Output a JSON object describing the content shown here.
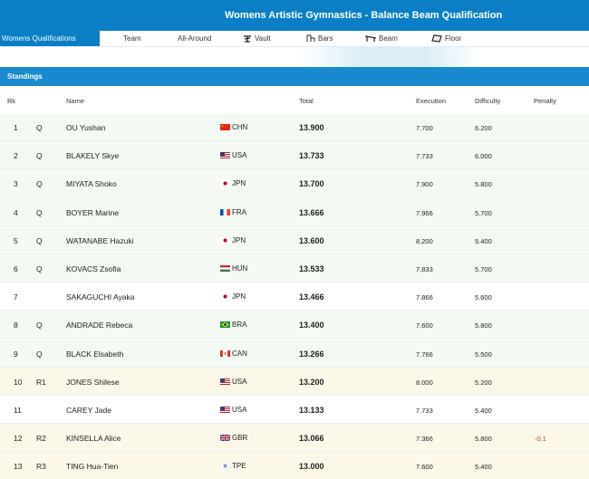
{
  "header": {
    "title": "Womens Artistic Gymnastics - Balance Beam Qualification"
  },
  "tabs": [
    {
      "label": "Womens Qualifications",
      "icon": "",
      "active": true
    },
    {
      "label": "Team",
      "icon": ""
    },
    {
      "label": "All-Around",
      "icon": ""
    },
    {
      "label": "Vault",
      "icon": "vault-icon"
    },
    {
      "label": "Bars",
      "icon": "bars-icon"
    },
    {
      "label": "Beam",
      "icon": "beam-icon"
    },
    {
      "label": "Floor",
      "icon": "floor-icon"
    }
  ],
  "standings": {
    "label": "Standings"
  },
  "columns": {
    "rk": "Rk",
    "name": "Name",
    "total": "Total",
    "execution": "Execution",
    "difficulty": "Difficulty",
    "penalty": "Penalty"
  },
  "colors": {
    "accent": "#0a7fc6",
    "qualified_bg": "#f4faf3",
    "reserve_bg": "#fbf8e8"
  },
  "rows": [
    {
      "rk": "1",
      "q": "Q",
      "name": "OU Yushan",
      "country": "CHN",
      "total": "13.900",
      "execution": "7.700",
      "difficulty": "6.200",
      "penalty": "",
      "status": "qual"
    },
    {
      "rk": "2",
      "q": "Q",
      "name": "BLAKELY Skye",
      "country": "USA",
      "total": "13.733",
      "execution": "7.733",
      "difficulty": "6.000",
      "penalty": "",
      "status": "qual"
    },
    {
      "rk": "3",
      "q": "Q",
      "name": "MIYATA Shoko",
      "country": "JPN",
      "total": "13.700",
      "execution": "7.900",
      "difficulty": "5.800",
      "penalty": "",
      "status": "qual"
    },
    {
      "rk": "4",
      "q": "Q",
      "name": "BOYER Marine",
      "country": "FRA",
      "total": "13.666",
      "execution": "7.966",
      "difficulty": "5.700",
      "penalty": "",
      "status": "qual"
    },
    {
      "rk": "5",
      "q": "Q",
      "name": "WATANABE Hazuki",
      "country": "JPN",
      "total": "13.600",
      "execution": "8.200",
      "difficulty": "5.400",
      "penalty": "",
      "status": "qual"
    },
    {
      "rk": "6",
      "q": "Q",
      "name": "KOVACS Zsofia",
      "country": "HUN",
      "total": "13.533",
      "execution": "7.833",
      "difficulty": "5.700",
      "penalty": "",
      "status": "qual"
    },
    {
      "rk": "7",
      "q": "",
      "name": "SAKAGUCHI Ayaka",
      "country": "JPN",
      "total": "13.466",
      "execution": "7.866",
      "difficulty": "5.600",
      "penalty": "",
      "status": "none"
    },
    {
      "rk": "8",
      "q": "Q",
      "name": "ANDRADE Rebeca",
      "country": "BRA",
      "total": "13.400",
      "execution": "7.600",
      "difficulty": "5.800",
      "penalty": "",
      "status": "qual"
    },
    {
      "rk": "9",
      "q": "Q",
      "name": "BLACK Elsabeth",
      "country": "CAN",
      "total": "13.266",
      "execution": "7.766",
      "difficulty": "5.500",
      "penalty": "",
      "status": "qual"
    },
    {
      "rk": "10",
      "q": "R1",
      "name": "JONES Shilese",
      "country": "USA",
      "total": "13.200",
      "execution": "8.000",
      "difficulty": "5.200",
      "penalty": "",
      "status": "reserve"
    },
    {
      "rk": "11",
      "q": "",
      "name": "CAREY Jade",
      "country": "USA",
      "total": "13.133",
      "execution": "7.733",
      "difficulty": "5.400",
      "penalty": "",
      "status": "none"
    },
    {
      "rk": "12",
      "q": "R2",
      "name": "KINSELLA Alice",
      "country": "GBR",
      "total": "13.066",
      "execution": "7.366",
      "difficulty": "5.800",
      "penalty": "-0.1",
      "status": "reserve"
    },
    {
      "rk": "13",
      "q": "R3",
      "name": "TING Hua-Tien",
      "country": "TPE",
      "total": "13.000",
      "execution": "7.600",
      "difficulty": "5.400",
      "penalty": "",
      "status": "reserve"
    }
  ]
}
